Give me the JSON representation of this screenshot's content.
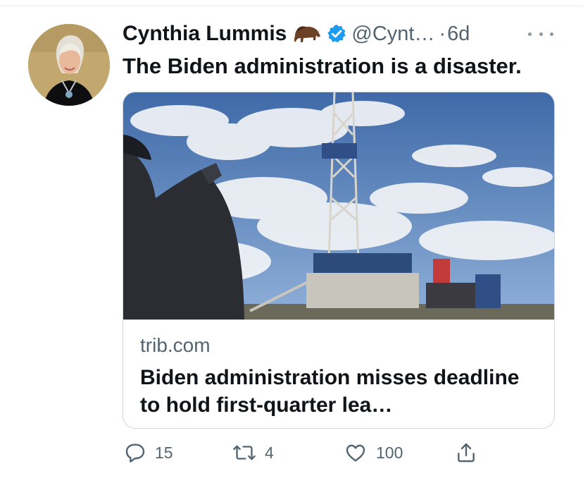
{
  "tweet": {
    "author_name": "Cynthia Lummis",
    "handle": "@Cynt…",
    "separator": "·",
    "time": "6d",
    "text": "The Biden administration is a disaster."
  },
  "card": {
    "domain": "trib.com",
    "title": "Biden administration misses deadline to hold first-quarter lea…"
  },
  "actions": {
    "reply_count": "15",
    "retweet_count": "4",
    "like_count": "100"
  },
  "icons": {
    "author_emoji": "bison-icon",
    "verified": "verified-badge-icon",
    "more": "more-icon",
    "reply": "reply-icon",
    "retweet": "retweet-icon",
    "like": "heart-icon",
    "share": "share-icon"
  },
  "colors": {
    "verified": "#1d9bf0",
    "secondary_text": "#536471",
    "card_border": "#cfd9de"
  }
}
